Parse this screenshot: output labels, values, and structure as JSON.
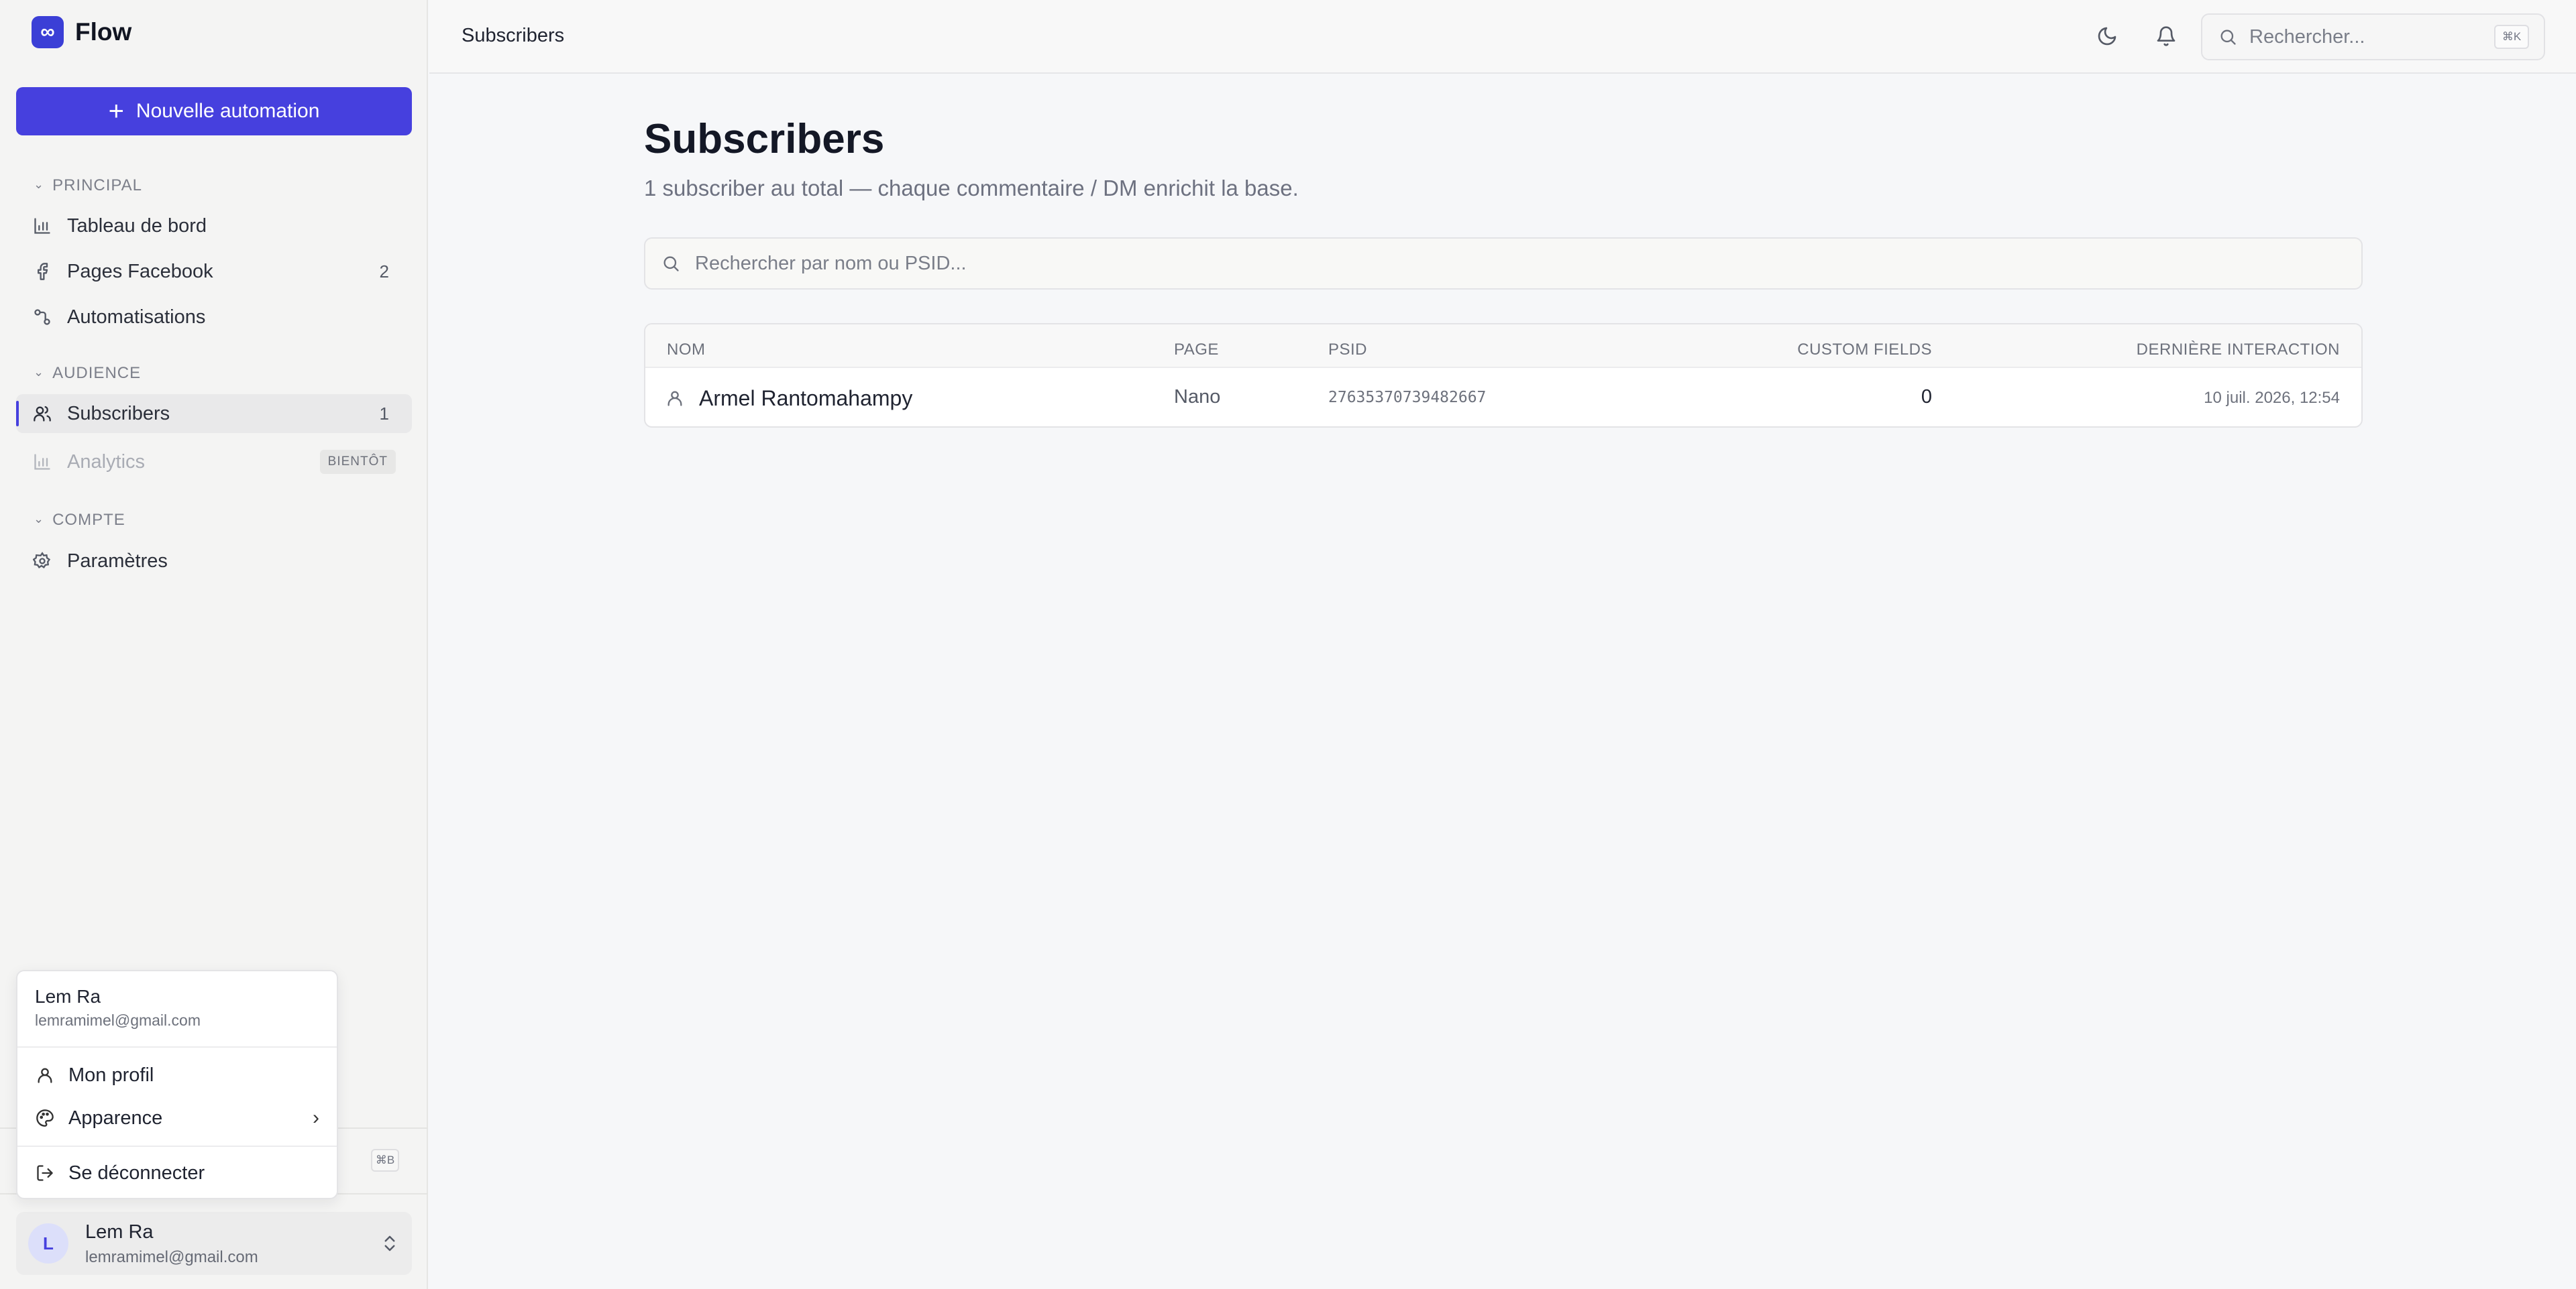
{
  "app": {
    "logo_glyph": "∞",
    "name": "Flow",
    "accent_color": "#4640de"
  },
  "sidebar": {
    "new_button": {
      "label": "Nouvelle automation",
      "icon": "plus-icon"
    },
    "sections": [
      {
        "label": "PRINCIPAL",
        "items": [
          {
            "label": "Tableau de bord",
            "icon": "bar-chart-icon",
            "count": ""
          },
          {
            "label": "Pages Facebook",
            "icon": "facebook-icon",
            "count": "2"
          },
          {
            "label": "Automatisations",
            "icon": "workflow-icon",
            "count": ""
          }
        ]
      },
      {
        "label": "AUDIENCE",
        "items": [
          {
            "label": "Subscribers",
            "icon": "users-icon",
            "count": "1",
            "active": true
          },
          {
            "label": "Analytics",
            "icon": "bar-chart-icon",
            "badge": "BIENTÔT",
            "disabled": true
          }
        ]
      },
      {
        "label": "COMPTE",
        "items": [
          {
            "label": "Paramètres",
            "icon": "gear-icon",
            "count": ""
          }
        ]
      }
    ],
    "shortcut_hint": "⌘B",
    "user": {
      "initial": "L",
      "name": "Lem Ra",
      "email": "lemramimel@gmail.com"
    }
  },
  "user_menu": {
    "name": "Lem Ra",
    "email": "lemramimel@gmail.com",
    "items": [
      {
        "label": "Mon profil",
        "icon": "user-icon"
      },
      {
        "label": "Apparence",
        "icon": "palette-icon",
        "has_submenu": true
      },
      {
        "label": "Se déconnecter",
        "icon": "logout-icon"
      }
    ]
  },
  "topbar": {
    "breadcrumb": "Subscribers",
    "search_placeholder": "Rechercher...",
    "search_shortcut": "⌘K",
    "icons": [
      "moon-icon",
      "bell-icon"
    ]
  },
  "main": {
    "title": "Subscribers",
    "subtitle": "1 subscriber au total — chaque commentaire / DM enrichit la base.",
    "search_placeholder": "Rechercher par nom ou PSID...",
    "table": {
      "columns": [
        "NOM",
        "PAGE",
        "PSID",
        "CUSTOM FIELDS",
        "DERNIÈRE INTERACTION"
      ],
      "rows": [
        {
          "name": "Armel Rantomahampy",
          "page": "Nano",
          "psid": "27635370739482667",
          "custom_fields": "0",
          "last_interaction": "10 juil. 2026, 12:54"
        }
      ]
    }
  }
}
